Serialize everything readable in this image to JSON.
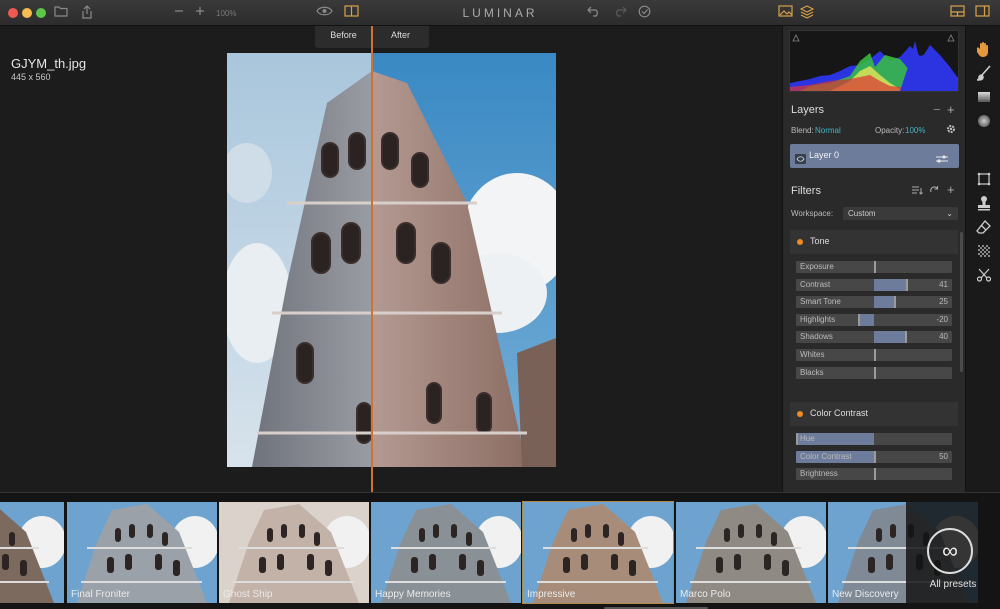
{
  "app": {
    "title": "LUMINAR",
    "zoom": "100%"
  },
  "toolbar_icons": [
    "folder-icon",
    "share-icon",
    "zoom-out-icon",
    "zoom-in-icon",
    "eye-icon",
    "compare-icon",
    "undo-icon",
    "redo-icon",
    "history-icon",
    "image-icon",
    "layers-icon",
    "panel-bottom-icon",
    "panel-right-icon"
  ],
  "file": {
    "name": "GJYM_th.jpg",
    "size": "445 x 560"
  },
  "compare": {
    "before": "Before",
    "after": "After"
  },
  "layers": {
    "title": "Layers",
    "blend_label": "Blend:",
    "blend_value": "Normal",
    "opacity_label": "Opacity:",
    "opacity_value": "100%",
    "layer_name": "Layer 0"
  },
  "filters": {
    "title": "Filters",
    "workspace_label": "Workspace:",
    "workspace_value": "Custom",
    "groups": [
      {
        "name": "Tone",
        "sliders": [
          {
            "label": "Exposure",
            "value": "",
            "level": 0
          },
          {
            "label": "Contrast",
            "value": "41",
            "level": 41
          },
          {
            "label": "Smart Tone",
            "value": "25",
            "level": 25
          },
          {
            "label": "Highlights",
            "value": "-20",
            "level": -20
          },
          {
            "label": "Shadows",
            "value": "40",
            "level": 40
          },
          {
            "label": "Whites",
            "value": "",
            "level": 0
          },
          {
            "label": "Blacks",
            "value": "",
            "level": 0
          }
        ]
      },
      {
        "name": "Color Contrast",
        "sliders": [
          {
            "label": "Hue",
            "value": "",
            "level": -100
          },
          {
            "label": "Color Contrast",
            "value": "50",
            "level": 0
          },
          {
            "label": "Brightness",
            "value": "",
            "level": 0
          }
        ]
      }
    ]
  },
  "tools": [
    "hand-icon",
    "brush-icon",
    "gradient-icon",
    "radial-icon",
    "crop-icon",
    "stamp-icon",
    "eraser-icon",
    "noise-icon",
    "cut-icon"
  ],
  "presets": {
    "items": [
      "",
      "Final Froniter",
      "Ghost Ship",
      "Happy Memories",
      "Impressive",
      "Marco Polo",
      "New Discovery"
    ],
    "selected": "Impressive",
    "all_label": "All presets",
    "all_symbol": "∞"
  },
  "colors": {
    "accent": "#d37130",
    "layer_highlight": "#6c7c9a",
    "teal": "#45b3c8",
    "tone_dot": "#f08a24"
  }
}
